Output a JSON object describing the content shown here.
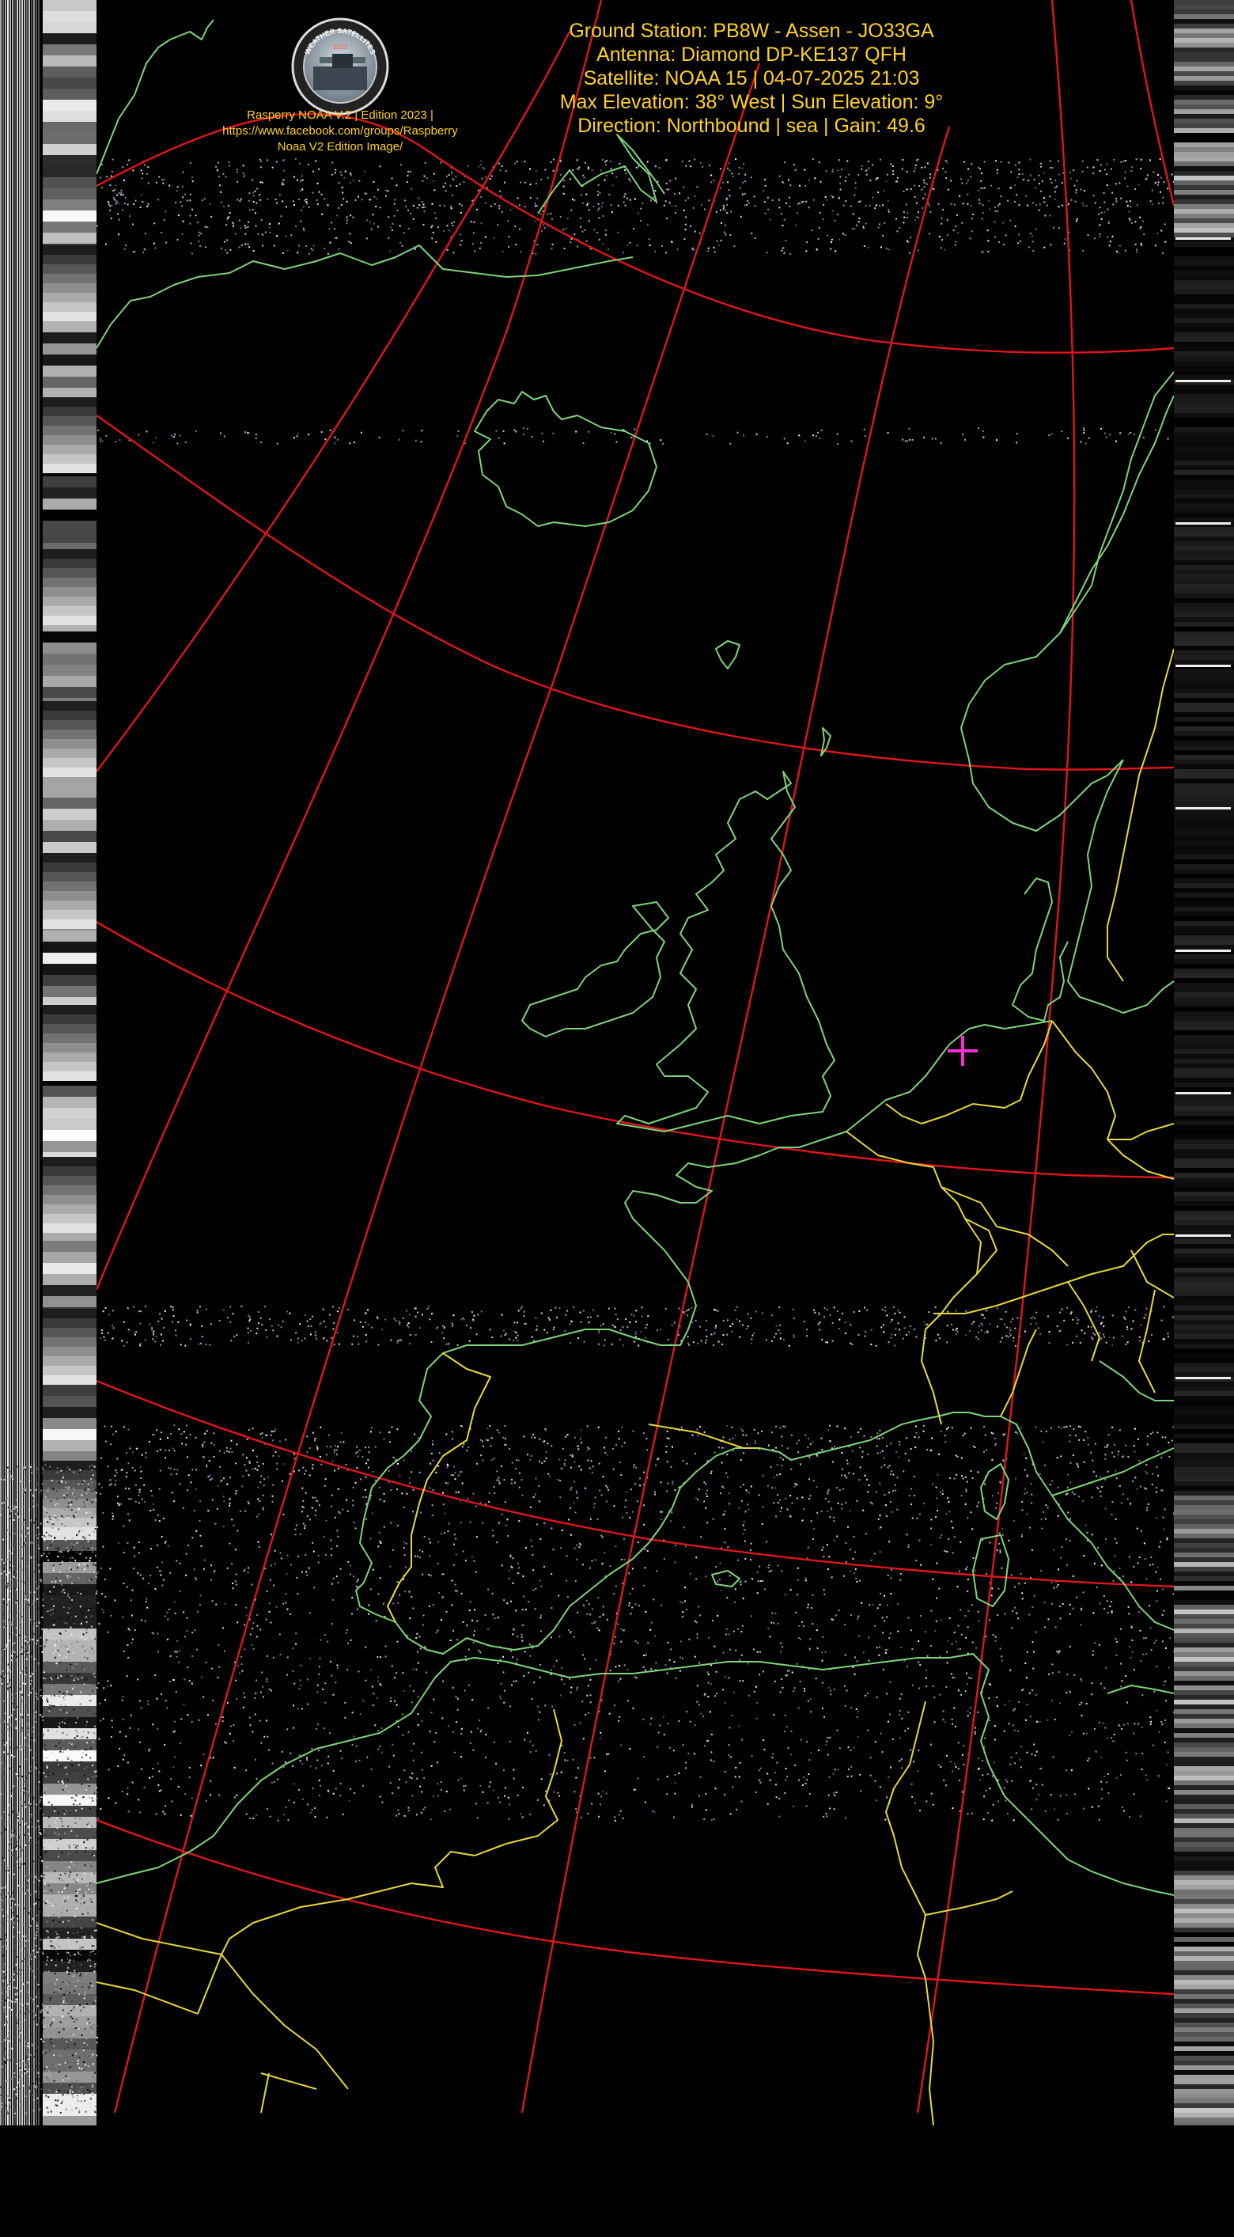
{
  "header": {
    "line1": "Ground Station: PB8W - Assen - JO33GA",
    "line2": "Antenna: Diamond DP-KE137 QFH",
    "line3": "Satellite: NOAA 15 | 04-07-2025 21:03",
    "line4": "Max Elevation: 38° West | Sun Elevation: 9°",
    "line5": "Direction: Northbound | sea | Gain: 49.6"
  },
  "logo": {
    "name": "weather-satellites-badge",
    "ring_text": "WEATHER SATELLITES",
    "year": "2023"
  },
  "caption": {
    "line1": "Rasperry NOAA V.2 | Edition 2023 |",
    "line2": "https://www.facebook.com/groups/Raspberry",
    "line3": "Noaa V2 Edition Image/"
  },
  "colors": {
    "text": "#ffd21f",
    "grid": "#e0161c",
    "coastline": "#7fd37a",
    "borders": "#e6d83a",
    "station_marker": "#ff2bd6",
    "background": "#000000"
  },
  "map": {
    "image_type": "NOAA APT satellite pass image",
    "overlays": [
      "lat-lon-grid",
      "coastlines",
      "country-borders",
      "ground-station-marker"
    ]
  }
}
